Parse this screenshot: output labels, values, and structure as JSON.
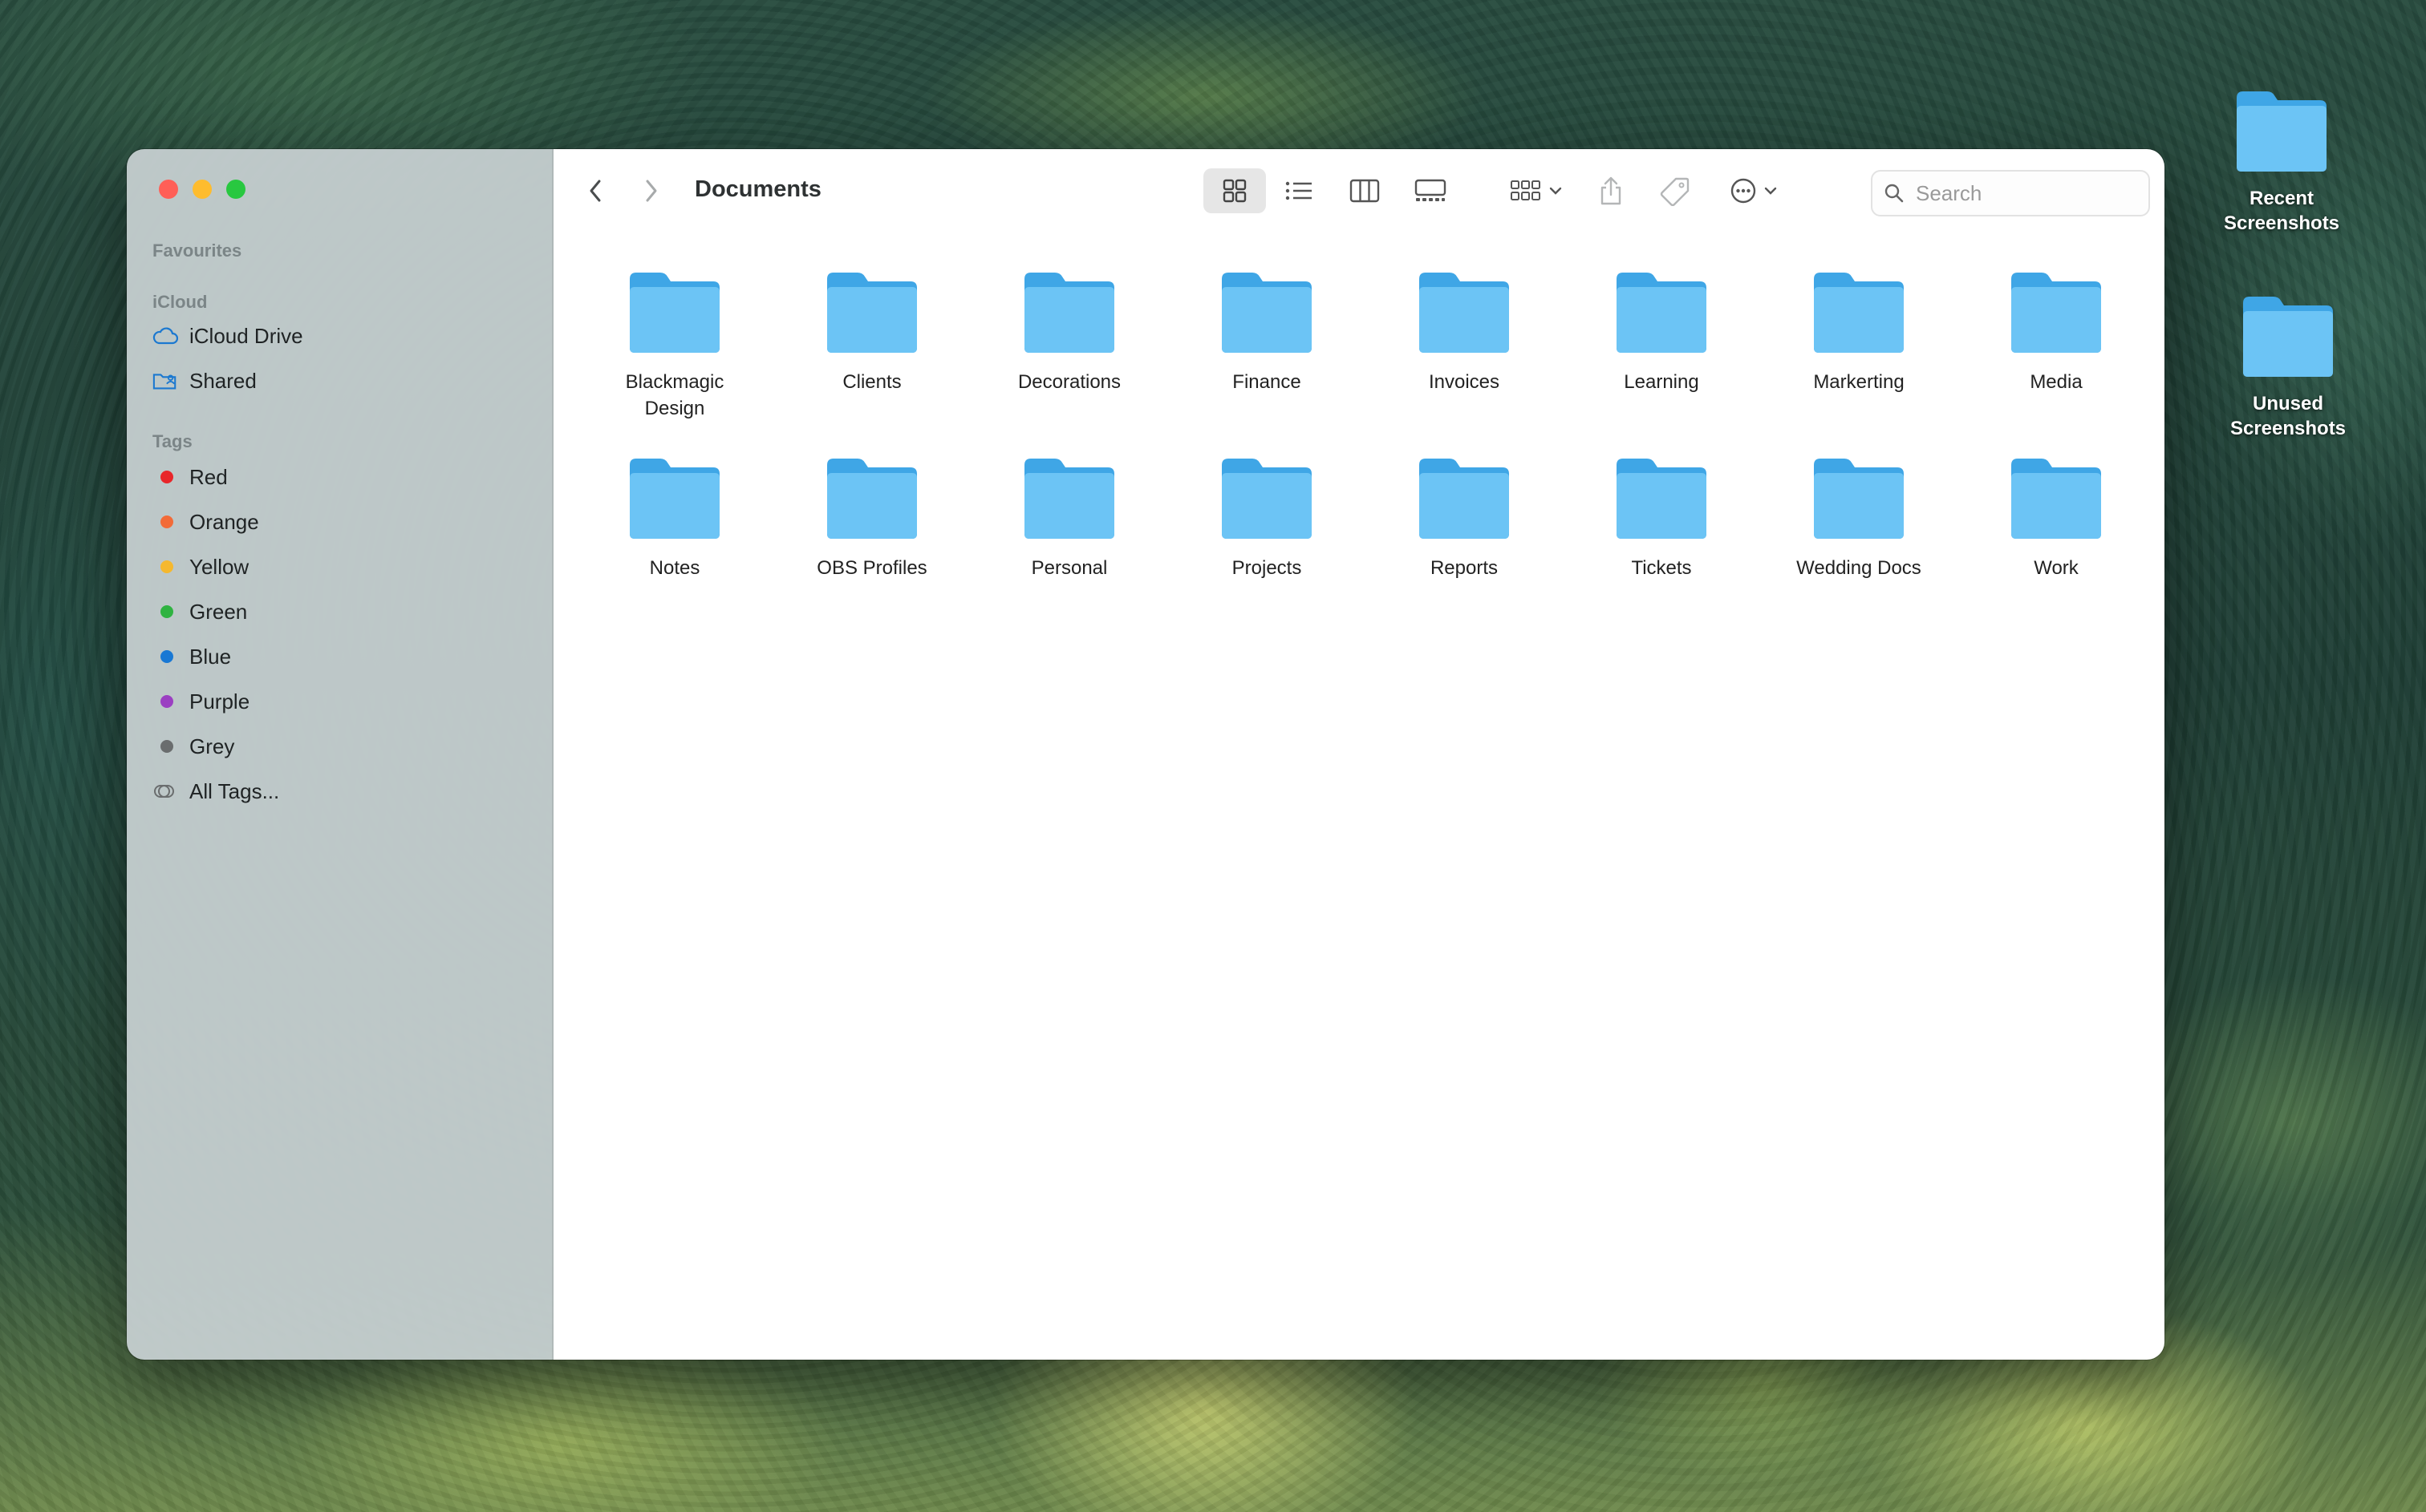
{
  "window": {
    "title": "Documents",
    "traffic_lights": {
      "close": "#ff5f57",
      "minimize": "#febc2e",
      "zoom": "#28c840"
    }
  },
  "sidebar": {
    "favourites_title": "Favourites",
    "icloud_title": "iCloud",
    "icloud_items": [
      {
        "label": "iCloud Drive",
        "icon": "cloud-icon"
      },
      {
        "label": "Shared",
        "icon": "shared-folder-icon"
      }
    ],
    "tags_title": "Tags",
    "tags": [
      {
        "label": "Red",
        "color": "#e8262a"
      },
      {
        "label": "Orange",
        "color": "#f26b38"
      },
      {
        "label": "Yellow",
        "color": "#f5b82e"
      },
      {
        "label": "Green",
        "color": "#2fb341"
      },
      {
        "label": "Blue",
        "color": "#1978d4"
      },
      {
        "label": "Purple",
        "color": "#9b3fc2"
      },
      {
        "label": "Grey",
        "color": "#6a6d6e"
      }
    ],
    "all_tags_label": "All Tags..."
  },
  "toolbar": {
    "back_icon": "chevron-left-icon",
    "forward_icon": "chevron-right-icon",
    "view_modes": [
      "icon-view",
      "list-view",
      "column-view",
      "gallery-view"
    ],
    "active_view": "icon-view",
    "group_icon": "group-by-icon",
    "share_icon": "share-icon",
    "tag_icon": "tag-icon",
    "more_icon": "ellipsis-circle-icon",
    "search_placeholder": "Search"
  },
  "folders": [
    "Blackmagic Design",
    "Clients",
    "Decorations",
    "Finance",
    "Invoices",
    "Learning",
    "Markerting",
    "Media",
    "Notes",
    "OBS Profiles",
    "Personal",
    "Projects",
    "Reports",
    "Tickets",
    "Wedding Docs",
    "Work"
  ],
  "desktop": {
    "items": [
      {
        "label": "Recent Screenshots"
      },
      {
        "label": "Unused Screenshots"
      }
    ]
  },
  "colors": {
    "folder_blue": "#6cc4f5",
    "folder_tab": "#3fa6e6"
  }
}
